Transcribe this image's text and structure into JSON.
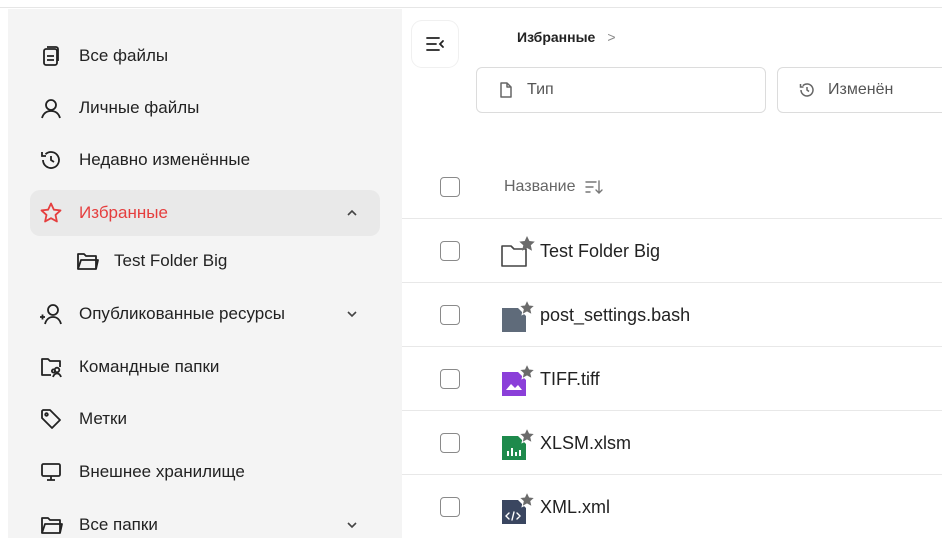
{
  "sidebar": {
    "items": [
      {
        "label": "Все файлы",
        "icon": "files-icon"
      },
      {
        "label": "Личные файлы",
        "icon": "user-icon"
      },
      {
        "label": "Недавно изменённые",
        "icon": "history-icon"
      },
      {
        "label": "Избранные",
        "icon": "star-icon",
        "active": true,
        "expanded": true
      },
      {
        "label": "Test Folder Big",
        "icon": "folder-icon"
      },
      {
        "label": "Опубликованные ресурсы",
        "icon": "share-user-icon"
      },
      {
        "label": "Командные папки",
        "icon": "team-folder-icon"
      },
      {
        "label": "Метки",
        "icon": "tag-icon"
      },
      {
        "label": "Внешнее хранилище",
        "icon": "monitor-icon"
      },
      {
        "label": "Все папки",
        "icon": "folder-open-icon"
      }
    ]
  },
  "header": {
    "breadcrumb": "Избранные",
    "breadcrumb_sep": ">"
  },
  "filters": {
    "type_label": "Тип",
    "modified_label": "Изменён"
  },
  "table": {
    "name_header": "Название",
    "rows": [
      {
        "name": "Test Folder Big",
        "icon": "folder-icon",
        "favorite": true
      },
      {
        "name": "post_settings.bash",
        "icon": "script-file-icon",
        "favorite": true
      },
      {
        "name": "TIFF.tiff",
        "icon": "image-file-icon",
        "favorite": true
      },
      {
        "name": "XLSM.xlsm",
        "icon": "spreadsheet-file-icon",
        "favorite": true
      },
      {
        "name": "XML.xml",
        "icon": "code-file-icon",
        "favorite": true
      }
    ]
  },
  "colors": {
    "accent": "#e53e3e",
    "sidebar_bg": "#f4f4f4",
    "active_bg": "#e9e9e9",
    "script_icon": "#5f6b7a",
    "image_icon": "#8b3fd9",
    "sheet_icon": "#1e8a4c",
    "xml_icon": "#3a4660",
    "star": "#6b6b6b"
  }
}
